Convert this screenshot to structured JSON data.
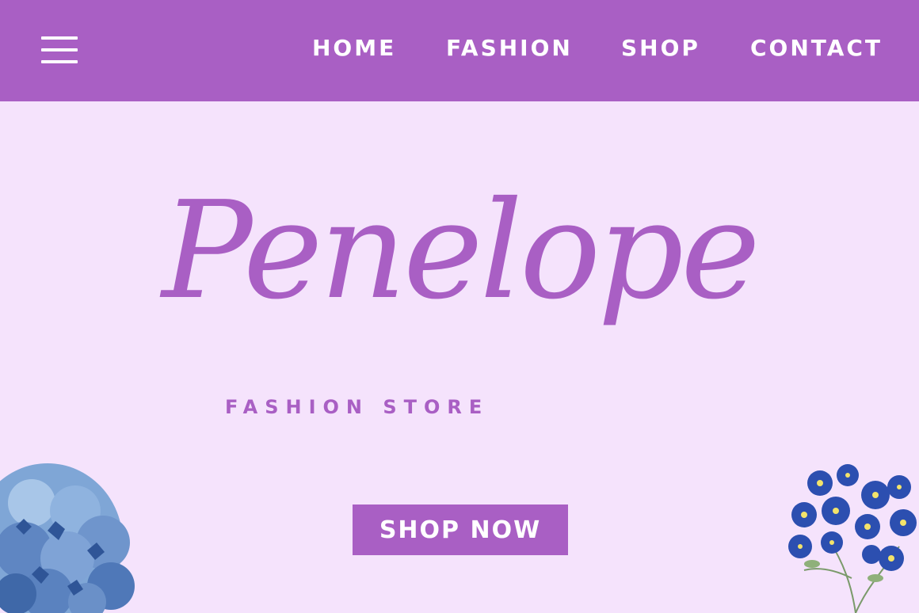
{
  "nav": {
    "menu_icon": "hamburger-menu-icon",
    "links": [
      {
        "label": "HOME"
      },
      {
        "label": "FASHION"
      },
      {
        "label": "SHOP"
      },
      {
        "label": "CONTACT"
      }
    ]
  },
  "hero": {
    "logo_text": "Penelope",
    "tagline": "FASHION STORE",
    "cta_label": "SHOP NOW"
  },
  "decor": {
    "left_flower": "blue-hydrangea-illustration",
    "right_flower": "forget-me-not-illustration"
  },
  "colors": {
    "background": "#f5e3fc",
    "brand_purple": "#a95fc4",
    "nav_text": "#ffffff",
    "flower_blue": "#3b5fb8"
  }
}
